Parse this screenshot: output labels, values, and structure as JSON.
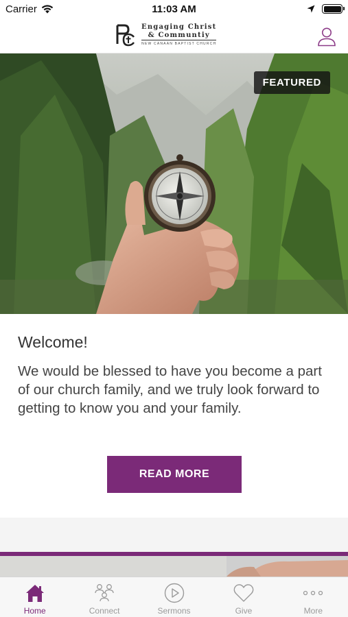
{
  "status_bar": {
    "carrier": "Carrier",
    "time": "11:03 AM"
  },
  "header": {
    "logo_line1": "Engaging Christ",
    "logo_line2": "& Communtiy",
    "logo_line3": "NEW CANAAN BAPTIST CHURCH",
    "profile_icon": "user-icon"
  },
  "hero": {
    "badge": "FEATURED"
  },
  "card": {
    "title": "Welcome!",
    "body": "We would be blessed to have you become a part of our church family, and we truly look forward to getting to know you and your family.",
    "button": "READ MORE"
  },
  "colors": {
    "accent": "#7b2a78",
    "badge_bg": "#1e1e1e"
  },
  "tabs": [
    {
      "label": "Home",
      "icon": "home-icon",
      "active": true
    },
    {
      "label": "Connect",
      "icon": "people-icon",
      "active": false
    },
    {
      "label": "Sermons",
      "icon": "play-circle-icon",
      "active": false
    },
    {
      "label": "Give",
      "icon": "heart-icon",
      "active": false
    },
    {
      "label": "More",
      "icon": "more-icon",
      "active": false
    }
  ]
}
